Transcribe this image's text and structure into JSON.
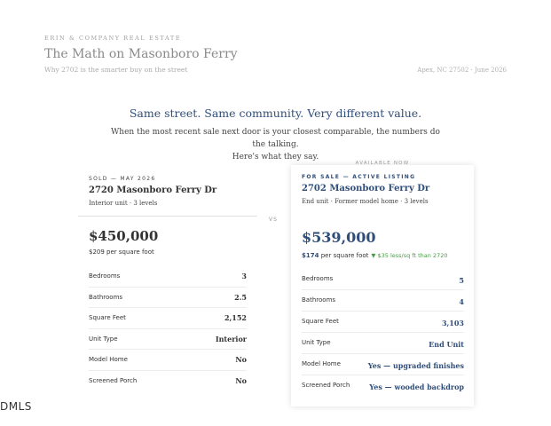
{
  "header": {
    "brand": "ERIN & COMPANY REAL ESTATE",
    "title": "The Math on Masonboro Ferry",
    "subtitle": "Why 2702 is the smarter buy on the street",
    "location": "Apex, NC 27502 · June 2026"
  },
  "intro": {
    "headline": "Same street. Same community. Very different value.",
    "line1": "When the most recent sale next door is your closest comparable, the numbers do the talking.",
    "line2": "Here's what they say."
  },
  "vs_label": "VS",
  "sold": {
    "status": "SOLD — MAY 2026",
    "address": "2720 Masonboro Ferry Dr",
    "meta": "Interior unit · 3 levels",
    "price": "$450,000",
    "ppsf": "$209 per square foot",
    "rows": [
      {
        "label": "Bedrooms",
        "value": "3"
      },
      {
        "label": "Bathrooms",
        "value": "2.5"
      },
      {
        "label": "Square Feet",
        "value": "2,152"
      },
      {
        "label": "Unit Type",
        "value": "Interior"
      },
      {
        "label": "Model Home",
        "value": "No"
      },
      {
        "label": "Screened Porch",
        "value": "No"
      }
    ]
  },
  "sale": {
    "flag": "AVAILABLE NOW",
    "status": "FOR SALE — ACTIVE LISTING",
    "address": "2702 Masonboro Ferry Dr",
    "meta": "End unit · Former model home · 3 levels",
    "price": "$539,000",
    "ppsf_amount": "$174",
    "ppsf_suffix": " per square foot",
    "delta": "▼ $35 less/sq ft than 2720",
    "rows": [
      {
        "label": "Bedrooms",
        "value": "5"
      },
      {
        "label": "Bathrooms",
        "value": "4"
      },
      {
        "label": "Square Feet",
        "value": "3,103"
      },
      {
        "label": "Unit Type",
        "value": "End Unit"
      },
      {
        "label": "Model Home",
        "value": "Yes — upgraded finishes"
      },
      {
        "label": "Screened Porch",
        "value": "Yes — wooded backdrop"
      }
    ]
  },
  "footer": {
    "mls_logo": "DMLS"
  },
  "colors": {
    "navy": "#2f4e7a",
    "green": "#4a9a4a"
  }
}
